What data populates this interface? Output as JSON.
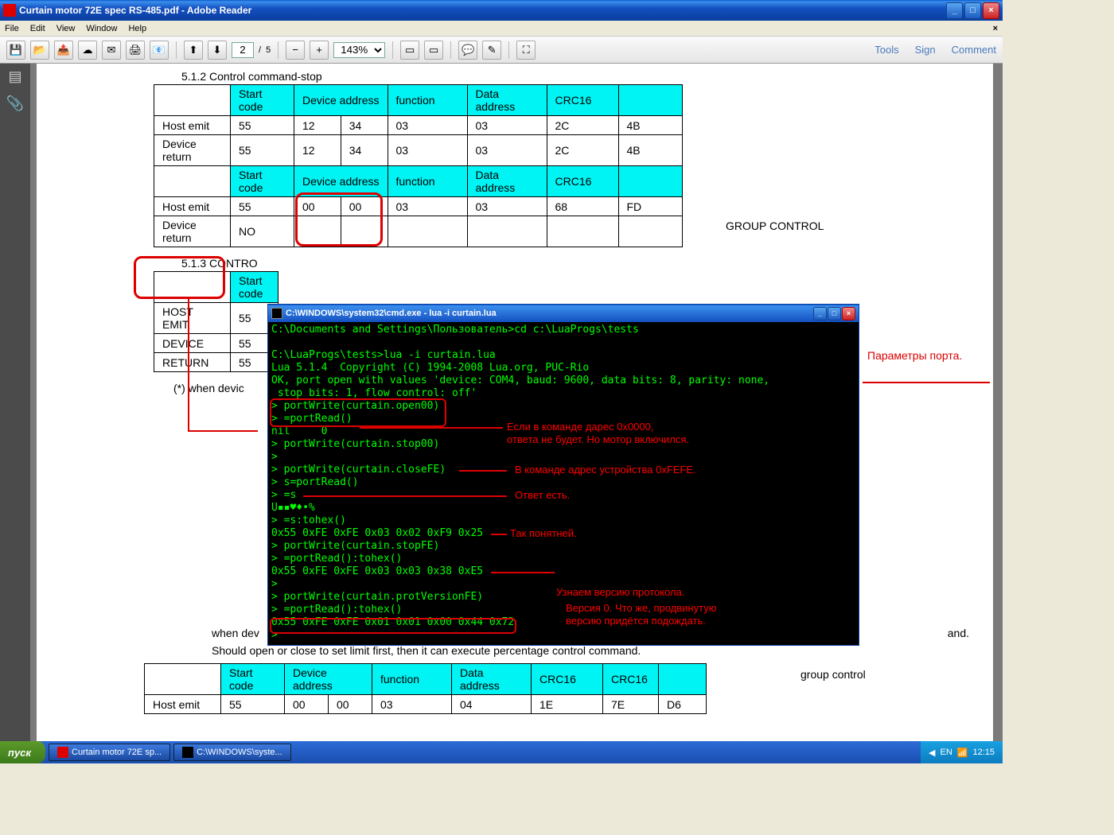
{
  "window": {
    "title": "Curtain motor 72E  spec RS-485.pdf - Adobe Reader",
    "min": "_",
    "max": "□",
    "close": "×"
  },
  "menu": {
    "file": "File",
    "edit": "Edit",
    "view": "View",
    "window": "Window",
    "help": "Help"
  },
  "toolbar": {
    "page_current": "2",
    "page_sep": "/",
    "page_total": "5",
    "zoom": "143%",
    "tools": "Tools",
    "sign": "Sign",
    "comment": "Comment"
  },
  "doc": {
    "sec512": "5.1.2   Control command-stop",
    "t1": {
      "h": [
        "",
        "Start code",
        "Device address",
        "",
        "function",
        "Data address",
        "CRC16",
        ""
      ],
      "r1": [
        "Host emit",
        "55",
        "12",
        "34",
        "03",
        "03",
        "2C",
        "4B"
      ],
      "r2": [
        "Device return",
        "55",
        "12",
        "34",
        "03",
        "03",
        "2C",
        "4B"
      ]
    },
    "t2": {
      "h": [
        "",
        "Start code",
        "Device address",
        "",
        "function",
        "Data address",
        "CRC16",
        ""
      ],
      "r1": [
        "Host emit",
        "55",
        "00",
        "00",
        "03",
        "03",
        "68",
        "FD"
      ],
      "r2": [
        "Device return",
        "NO",
        "",
        "",
        "",
        "",
        "",
        ""
      ]
    },
    "group": "GROUP CONTROL",
    "sec513": "5.1.3   CONTRO",
    "t3": {
      "h": [
        "",
        "Start code"
      ],
      "r1": [
        "HOST EMIT",
        "55"
      ],
      "r2": [
        "DEVICE",
        "55"
      ],
      "r3": [
        "RETURN",
        "55"
      ]
    },
    "note1": "(*) when devic",
    "note2": "when dev",
    "note3": "and.",
    "note4": "Should open or close to set limit first, then it can execute percentage control command.",
    "t4": {
      "h": [
        "",
        "Start code",
        "Device address",
        "",
        "function",
        "Data address",
        "CRC16",
        "CRC16",
        ""
      ],
      "r1": [
        "Host emit",
        "55",
        "00",
        "00",
        "03",
        "04",
        "1E",
        "7E",
        "D6"
      ]
    },
    "group2": "group control"
  },
  "cmd": {
    "title": "C:\\WINDOWS\\system32\\cmd.exe - lua -i curtain.lua",
    "l1": "C:\\Documents and Settings\\Пользователь>cd c:\\LuaProgs\\tests",
    "l2": "",
    "l3": "C:\\LuaProgs\\tests>lua -i curtain.lua",
    "l4": "Lua 5.1.4  Copyright (C) 1994-2008 Lua.org, PUC-Rio",
    "l5": "OK, port open with values 'device: COM4, baud: 9600, data bits: 8, parity: none,",
    "l6": " stop bits: 1, flow control: off'",
    "l7": "> portWrite(curtain.open00)",
    "l8": "> =portRead()",
    "l9": "nil     0",
    "l10": "> portWrite(curtain.stop00)",
    "l11": ">",
    "l12": "> portWrite(curtain.closeFE)",
    "l13": "> s=portRead()",
    "l14": "> =s",
    "l15": "U▪▪♥♦•%",
    "l16": "> =s:tohex()",
    "l17": "0x55 0xFE 0xFE 0x03 0x02 0xF9 0x25",
    "l18": "> portWrite(curtain.stopFE)",
    "l19": "> =portRead():tohex()",
    "l20": "0x55 0xFE 0xFE 0x03 0x03 0x38 0xE5",
    "l21": ">",
    "l22": "> portWrite(curtain.protVersionFE)",
    "l23": "> =portRead():tohex()",
    "l24": "0x55 0xFE 0xFE 0x01 0x01 0x00 0x44 0x72",
    "l25": ">",
    "ann_params": "Параметры порта.",
    "ann1a": "Если в команде дарес 0x0000,",
    "ann1b": "ответа не будет. Но мотор включился.",
    "ann2": "В команде адрес устройства 0xFEFE.",
    "ann3": "Ответ есть.",
    "ann4": "Так понятней.",
    "ann5": "Узнаем версию протокола.",
    "ann6a": "Версия 0. Что же, продвинутую",
    "ann6b": "версию придётся подождать."
  },
  "taskbar": {
    "start": "пуск",
    "task1": "Curtain motor 72E  sp...",
    "task2": "C:\\WINDOWS\\syste...",
    "time": "12:15"
  }
}
